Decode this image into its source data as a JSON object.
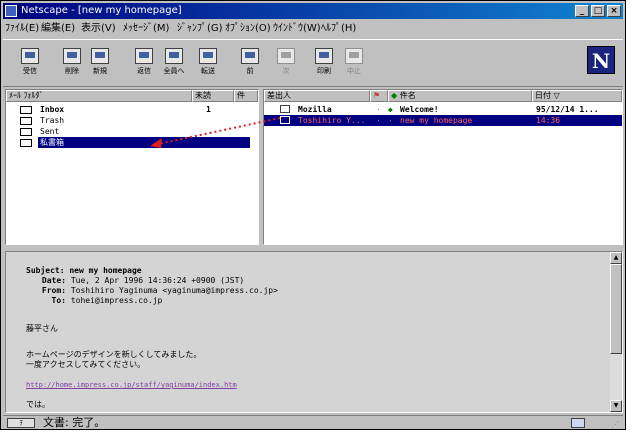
{
  "window": {
    "title": "Netscape - [new my homepage]",
    "controls": [
      "_",
      "□",
      "×"
    ]
  },
  "menu": [
    "ﾌｧｲﾙ(E)",
    "編集(E)",
    "表示(V)",
    "ﾒｯｾｰｼﾞ(M)",
    "ｼﾞｬﾝﾌﾟ(G)",
    "ｵﾌﾟｼｮﾝ(O)",
    "ｳｲﾝﾄﾞｳ(W)",
    "ﾍﾙﾌﾟ(H)"
  ],
  "toolbar": [
    {
      "label": "受信",
      "icon": "get-mail-icon"
    },
    {
      "label": "削除",
      "icon": "delete-icon"
    },
    {
      "label": "新規",
      "icon": "new-message-icon"
    },
    {
      "label": "返信",
      "icon": "reply-icon"
    },
    {
      "label": "全員へ",
      "icon": "reply-all-icon"
    },
    {
      "label": "転送",
      "icon": "forward-icon"
    },
    {
      "label": "前",
      "icon": "previous-icon"
    },
    {
      "label": "次",
      "icon": "next-icon"
    },
    {
      "label": "印刷",
      "icon": "print-icon"
    },
    {
      "label": "中止",
      "icon": "stop-icon"
    }
  ],
  "folders": {
    "headers": {
      "name": "ﾒｰﾙ ﾌｫﾙﾀﾞ",
      "unread": "未読",
      "total": "件"
    },
    "items": [
      {
        "name": "Inbox",
        "unread": "1"
      },
      {
        "name": "Trash",
        "unread": ""
      },
      {
        "name": "Sent",
        "unread": ""
      },
      {
        "name": "私書箱",
        "unread": ""
      }
    ]
  },
  "messages": {
    "headers": {
      "sender": "差出人",
      "subject": "件名",
      "date": "日付"
    },
    "rows": [
      {
        "sender": "Mozilla",
        "subject": "Welcome!",
        "date": "95/12/14 1..."
      },
      {
        "sender": "Toshihiro Y...",
        "subject": "new my homepage",
        "date": "14:36"
      }
    ]
  },
  "preview": {
    "subject_label": "Subject:",
    "subject": "new my homepage",
    "date_label": "Date:",
    "date": "Tue, 2 Apr 1996 14:36:24 +0900 (JST)",
    "from_label": "From:",
    "from": "Toshihiro Yaginuma <yaginuma@impress.co.jp>",
    "to_label": "To:",
    "to": "tohei@impress.co.jp",
    "greeting": "藤平さん",
    "body1": "ホームページのデザインを新しくしてみました。",
    "body2": "一度アクセスしてみてください。",
    "link": "http://home.impress.co.jp/staff/yaginuma/index.htm",
    "closing": "では。"
  },
  "status": {
    "text": "文書: 完了。"
  },
  "colors": {
    "title_bar": "#000080",
    "selection": "#000080",
    "arrow": "#e02020"
  }
}
